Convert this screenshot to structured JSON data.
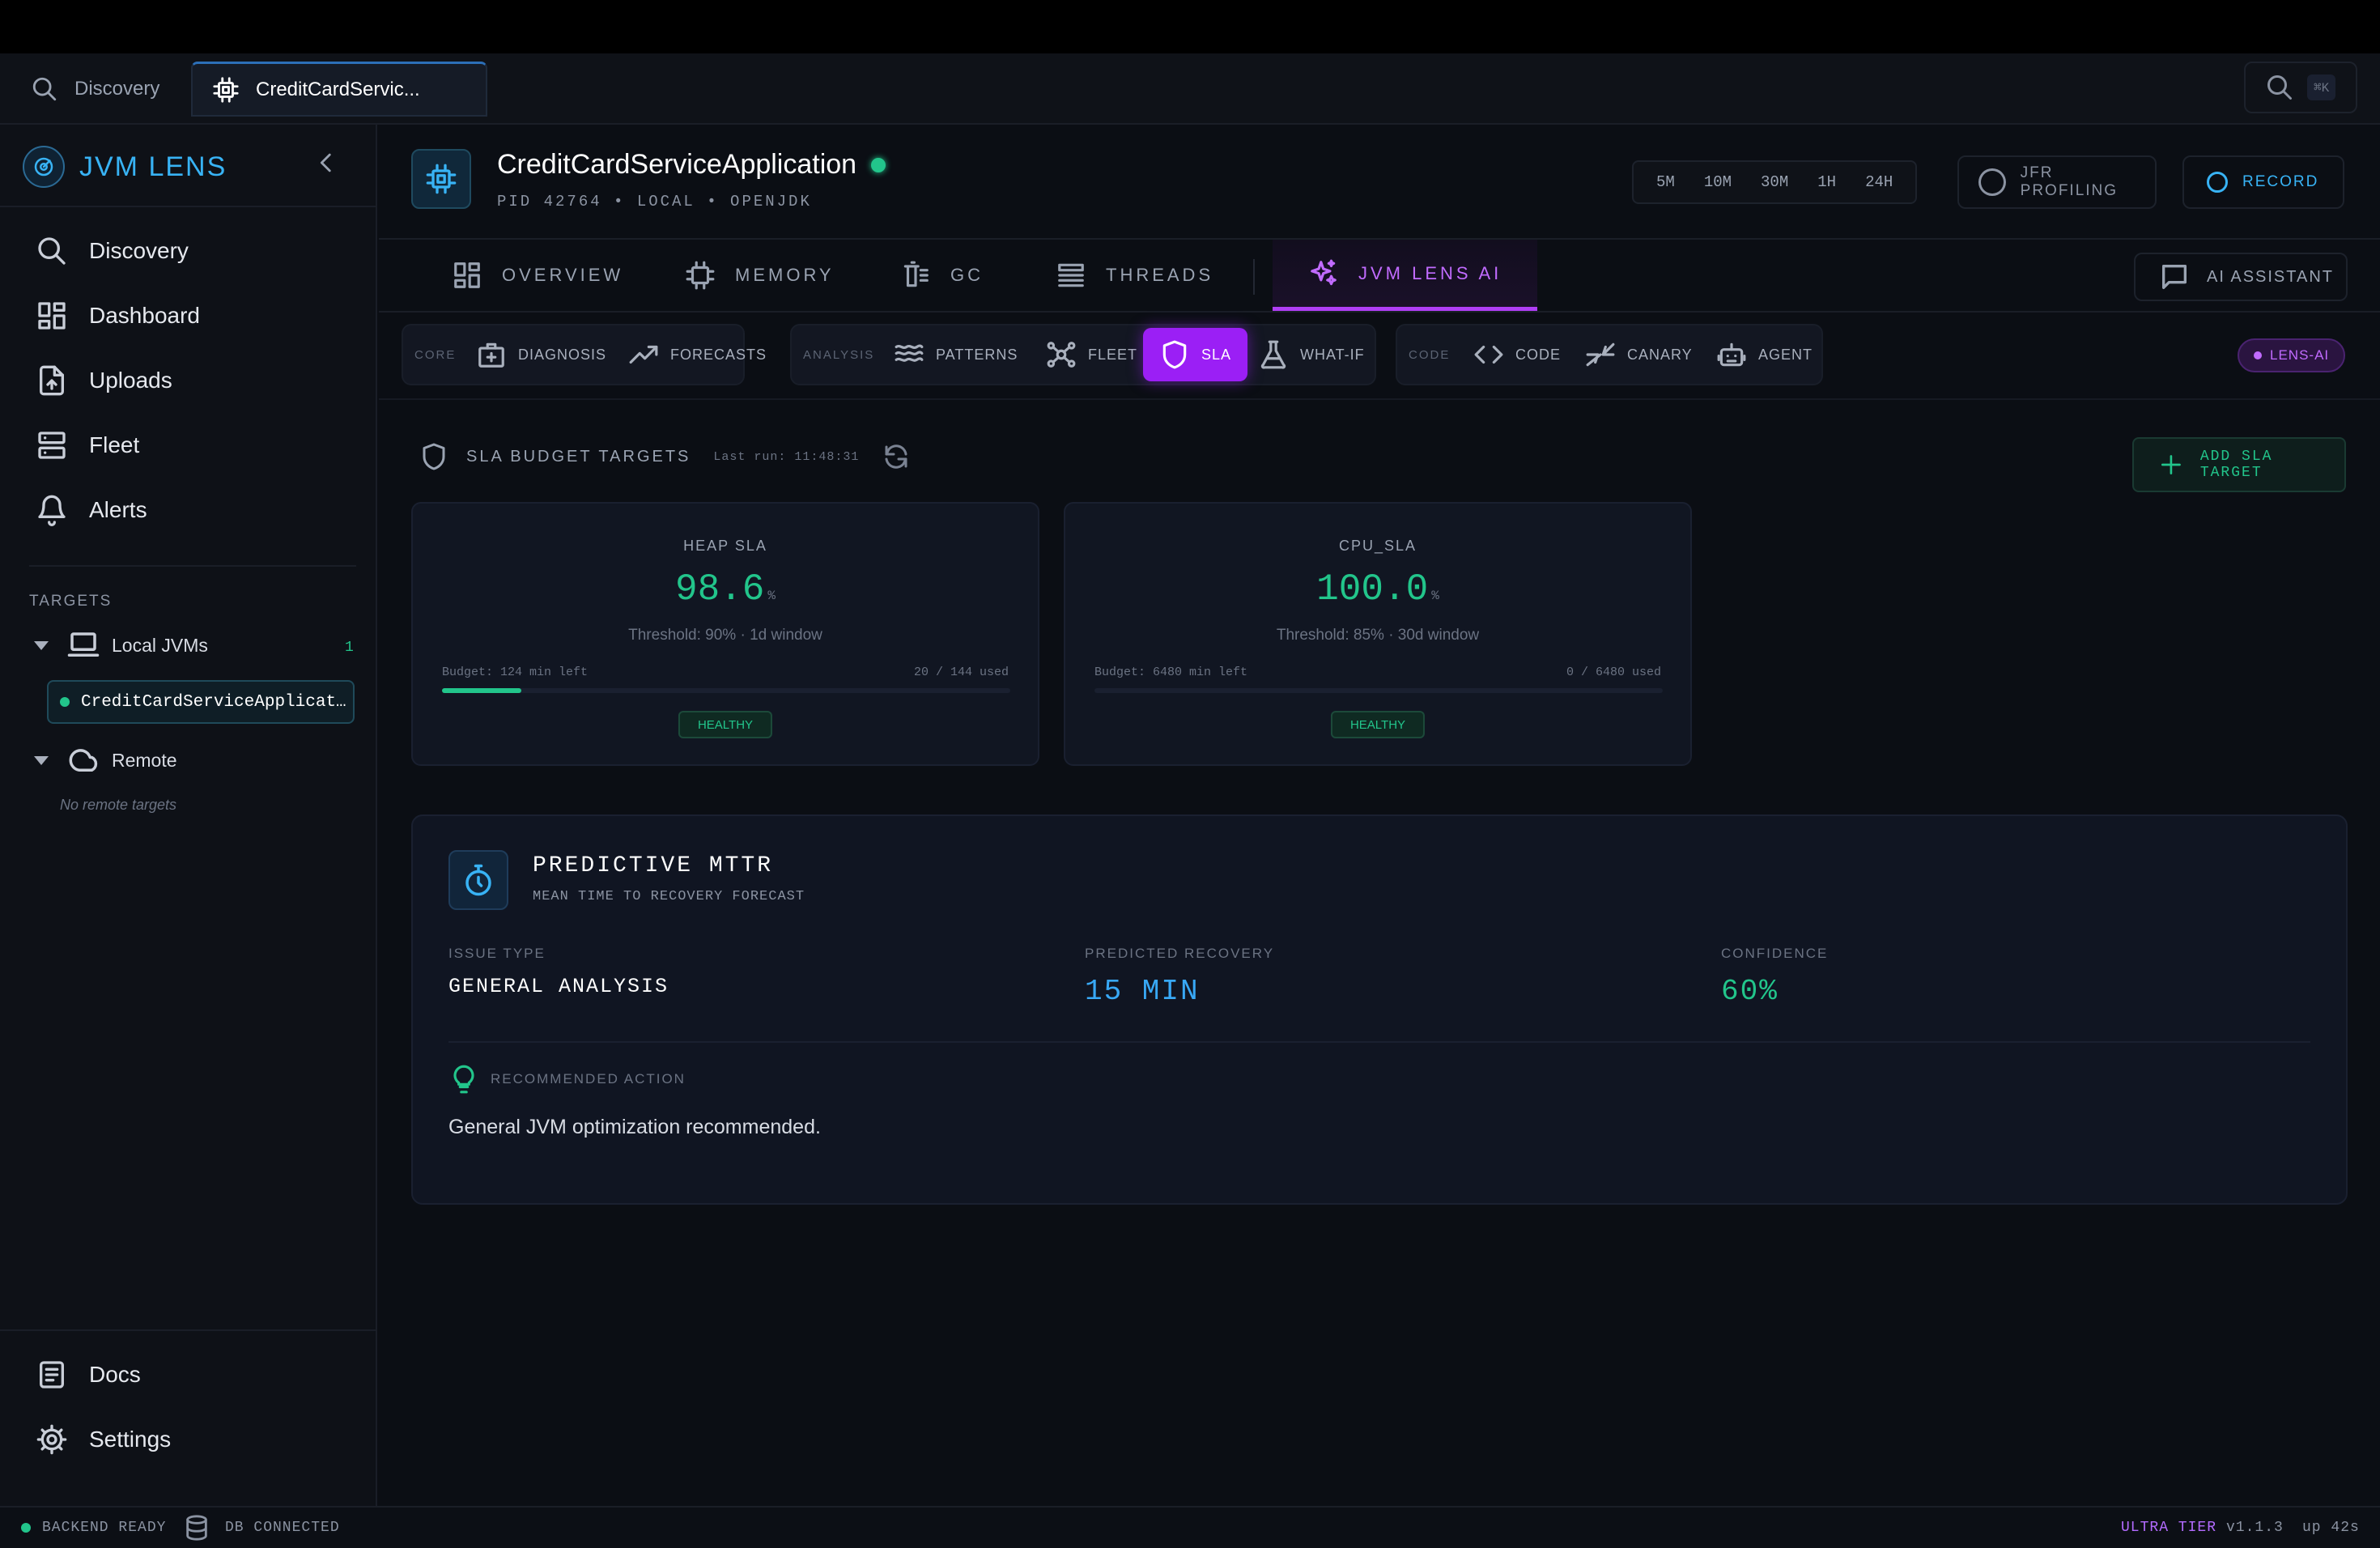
{
  "tabs": [
    {
      "label": "Discovery",
      "icon": "search-icon"
    },
    {
      "label": "CreditCardServic...",
      "icon": "chip-icon"
    }
  ],
  "search_shortcut": "⌘K",
  "brand": {
    "name": "JVM LENS"
  },
  "nav": [
    {
      "label": "Discovery",
      "icon": "search-icon"
    },
    {
      "label": "Dashboard",
      "icon": "dashboard-icon"
    },
    {
      "label": "Uploads",
      "icon": "upload-icon"
    },
    {
      "label": "Fleet",
      "icon": "server-icon"
    },
    {
      "label": "Alerts",
      "icon": "bell-icon"
    }
  ],
  "targets": {
    "section_label": "TARGETS",
    "local_label": "Local JVMs",
    "local_count": "1",
    "selected_target": "CreditCardServiceApplicat…",
    "remote_label": "Remote",
    "remote_empty": "No remote targets"
  },
  "footer_nav": [
    {
      "label": "Docs",
      "icon": "docs-icon"
    },
    {
      "label": "Settings",
      "icon": "gear-icon"
    }
  ],
  "app": {
    "title": "CreditCardServiceApplication",
    "subtitle": "PID 42764 • LOCAL • OPENJDK",
    "status_color": "#22c58b"
  },
  "time_ranges": [
    "5M",
    "10M",
    "30M",
    "1H",
    "24H"
  ],
  "header_buttons": {
    "jfr": "JFR PROFILING",
    "record": "RECORD",
    "ai_assistant": "AI ASSISTANT"
  },
  "main_tabs": [
    {
      "label": "OVERVIEW",
      "icon": "grid-icon"
    },
    {
      "label": "MEMORY",
      "icon": "chip-icon"
    },
    {
      "label": "GC",
      "icon": "trash-icon"
    },
    {
      "label": "THREADS",
      "icon": "list-icon"
    },
    {
      "label": "JVM LENS AI",
      "icon": "sparkle-icon",
      "active": true
    }
  ],
  "subnav": {
    "groups": [
      "CORE",
      "ANALYSIS",
      "CODE"
    ],
    "items": [
      {
        "label": "DIAGNOSIS",
        "icon": "medkit-icon"
      },
      {
        "label": "FORECASTS",
        "icon": "trend-icon"
      },
      {
        "label": "PATTERNS",
        "icon": "waves-icon"
      },
      {
        "label": "FLEET",
        "icon": "network-icon"
      },
      {
        "label": "SLA",
        "icon": "shield-icon",
        "active": true
      },
      {
        "label": "WHAT-IF",
        "icon": "flask-icon"
      },
      {
        "label": "CODE",
        "icon": "code-icon"
      },
      {
        "label": "CANARY",
        "icon": "merge-icon"
      },
      {
        "label": "AGENT",
        "icon": "robot-icon"
      }
    ],
    "badge": "LENS-AI"
  },
  "sla": {
    "title": "SLA BUDGET TARGETS",
    "last_run": "Last run: 11:48:31",
    "add_label": "ADD SLA TARGET",
    "cards": [
      {
        "name": "HEAP SLA",
        "value": "98.6",
        "unit": "%",
        "threshold": "Threshold: 90% · 1d window",
        "budget": "Budget: 124 min left",
        "used": "20 / 144 used",
        "used_fraction": 0.139,
        "status": "HEALTHY"
      },
      {
        "name": "CPU_SLA",
        "value": "100.0",
        "unit": "%",
        "threshold": "Threshold: 85% · 30d window",
        "budget": "Budget: 6480 min left",
        "used": "0 / 6480 used",
        "used_fraction": 0,
        "status": "HEALTHY"
      }
    ]
  },
  "mttr": {
    "title": "PREDICTIVE MTTR",
    "subtitle": "MEAN TIME TO RECOVERY FORECAST",
    "issue_label": "ISSUE TYPE",
    "issue_value": "GENERAL ANALYSIS",
    "recovery_label": "PREDICTED RECOVERY",
    "recovery_value": "15 MIN",
    "confidence_label": "CONFIDENCE",
    "confidence_value": "60%",
    "action_label": "RECOMMENDED ACTION",
    "action_text": "General JVM optimization recommended."
  },
  "status_bar": {
    "backend": "BACKEND READY",
    "db": "DB CONNECTED",
    "tier": "ULTRA TIER",
    "version": "v1.1.3",
    "uptime": "up 42s"
  }
}
